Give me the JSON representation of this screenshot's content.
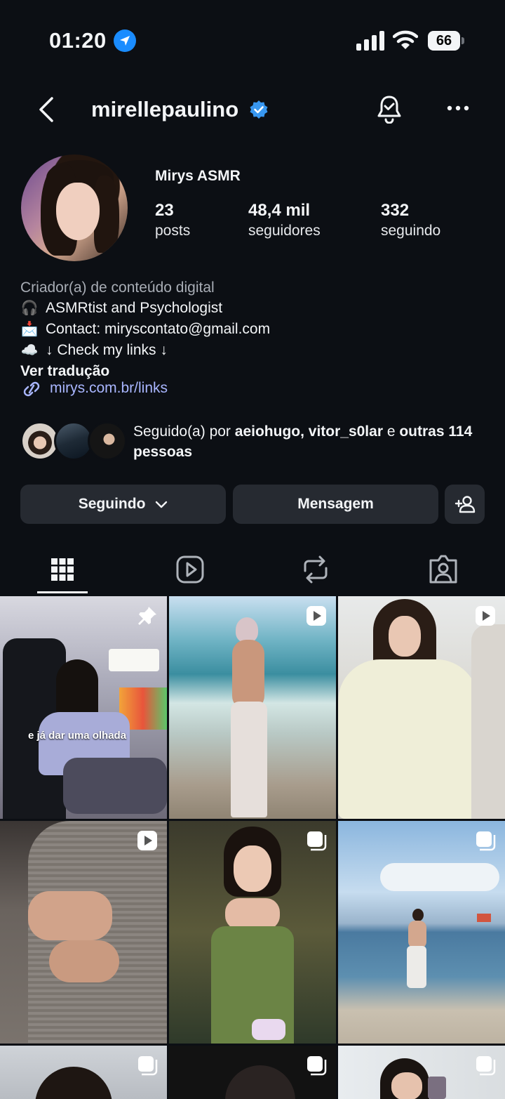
{
  "status_bar": {
    "time": "01:20",
    "battery": "66"
  },
  "header": {
    "username": "mirellepaulino"
  },
  "profile": {
    "display_name": "Mirys ASMR",
    "stats": [
      {
        "value": "23",
        "label": "posts"
      },
      {
        "value": "48,4 mil",
        "label": "seguidores"
      },
      {
        "value": "332",
        "label": "seguindo"
      }
    ],
    "category": "Criador(a) de conteúdo digital",
    "bio_lines": [
      {
        "emoji": "🎧",
        "text": "ASMRtist and Psychologist"
      },
      {
        "emoji": "📩",
        "text": "Contact: miryscontato@gmail.com"
      },
      {
        "emoji": "☁️",
        "text": "↓ Check my links ↓"
      }
    ],
    "translate": "Ver tradução",
    "link": "mirys.com.br/links"
  },
  "mutuals": {
    "prefix": "Seguido(a) por ",
    "names": "aeiohugo, vitor_s0lar",
    "joiner": " e ",
    "others": "outras 114 pessoas"
  },
  "buttons": {
    "following": "Seguindo",
    "message": "Mensagem"
  },
  "tabs": [
    "posts-grid",
    "reels",
    "reposts",
    "tagged"
  ],
  "grid": [
    {
      "badge": "pin-icon",
      "caption": "e já dar uma olhada"
    },
    {
      "badge": "reel-icon",
      "caption": ""
    },
    {
      "badge": "reel-icon",
      "caption": ""
    },
    {
      "badge": "reel-icon",
      "caption": ""
    },
    {
      "badge": "carousel-icon",
      "caption": ""
    },
    {
      "badge": "carousel-icon",
      "caption": ""
    },
    {
      "badge": "carousel-icon",
      "caption": ""
    },
    {
      "badge": "carousel-icon",
      "caption": ""
    },
    {
      "badge": "carousel-icon",
      "caption": ""
    }
  ],
  "colors": {
    "background": "#0c0f14",
    "button": "#262a31",
    "link": "#a9b6ff",
    "verified": "#3897f0"
  }
}
